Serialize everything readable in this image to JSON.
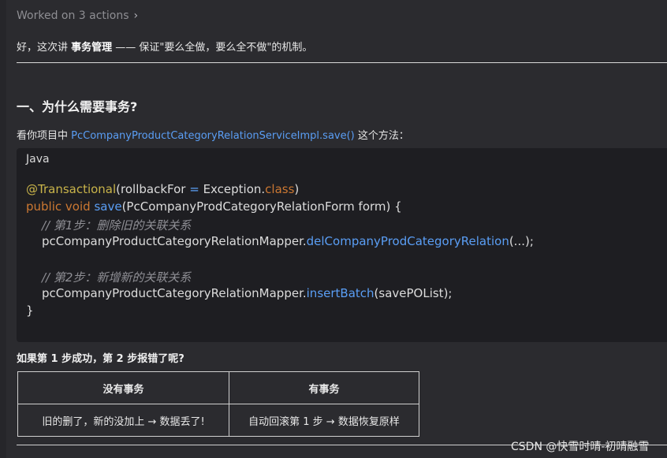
{
  "worked": {
    "label": "Worked on 3 actions"
  },
  "intro": {
    "prefix": "好，这次讲 ",
    "bold": "事务管理",
    "suffix": " —— 保证\"要么全做，要么全不做\"的机制。"
  },
  "section": {
    "heading": "一、为什么需要事务?"
  },
  "para": {
    "prefix": "看你项目中 ",
    "link": "PcCompanyProductCategoryRelationServiceImpl.save()",
    "suffix": " 这个方法："
  },
  "code": {
    "lang": "Java",
    "annotation": "@Transactional",
    "annotation_args_a": "(rollbackFor ",
    "annotation_eq": "=",
    "annotation_args_b": " Exception.",
    "annotation_class": "class",
    "annotation_close": ")",
    "sig_kw1": "public",
    "sig_kw2": "void",
    "sig_fn": "save",
    "sig_rest": "(PcCompanyProdCategoryRelationForm form) {",
    "comment1": "// 第1步：删除旧的关联关系",
    "l4_obj": "pcCompanyProductCategoryRelationMapper.",
    "l4_fn": "delCompanyProdCategoryRelation",
    "l4_rest": "(...);",
    "comment2": "// 第2步：新增新的关联关系",
    "l7_obj": "pcCompanyProductCategoryRelationMapper.",
    "l7_fn": "insertBatch",
    "l7_rest": "(savePOList);",
    "close": "}"
  },
  "question": "如果第 1 步成功，第 2 步报错了呢?",
  "table": {
    "headers": [
      "没有事务",
      "有事务"
    ],
    "row": [
      "旧的删了，新的没加上 → 数据丢了!",
      "自动回滚第 1 步 → 数据恢复原样"
    ]
  },
  "watermark": "CSDN @快雪时晴-初晴融雪",
  "colors": {
    "background": "#2b2b2f",
    "code_bg": "#1e1e22",
    "link": "#5a9ef5",
    "keyword": "#cc7832",
    "annotation": "#c9b44a",
    "comment": "#8f8f95"
  }
}
